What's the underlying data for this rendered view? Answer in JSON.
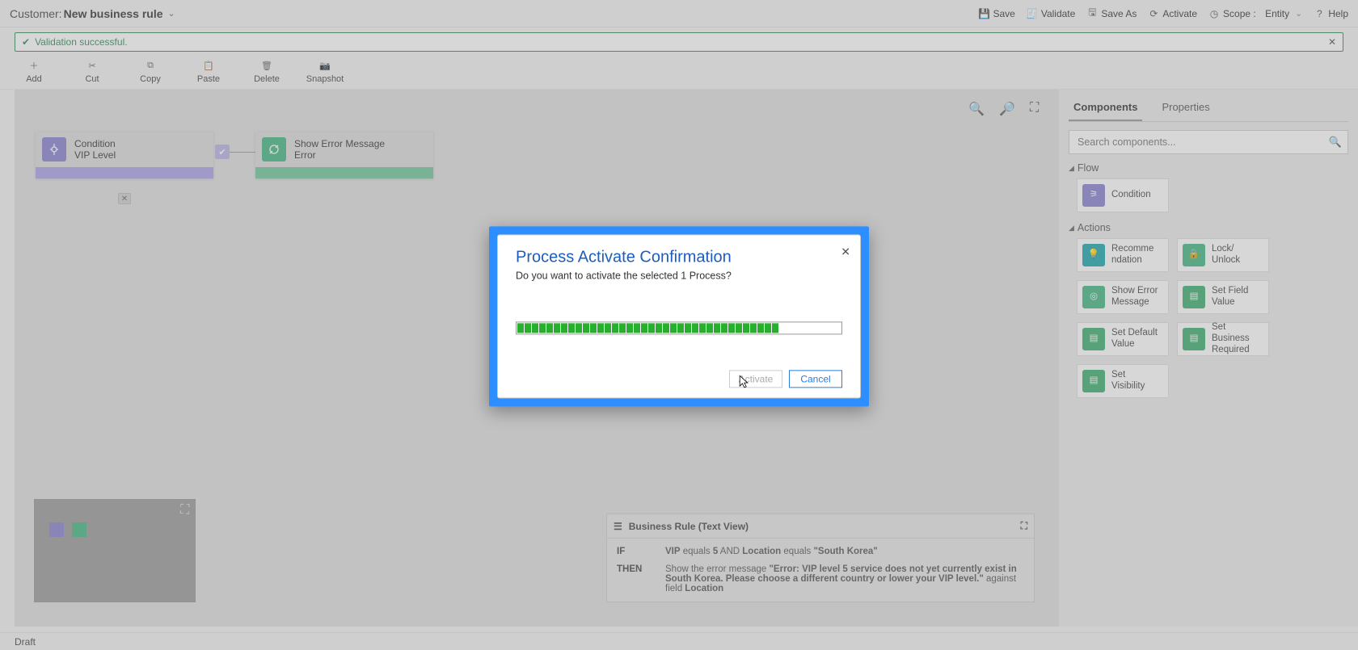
{
  "header": {
    "title_prefix": "Customer:",
    "title": "New business rule",
    "actions": {
      "save": "Save",
      "validate": "Validate",
      "save_as": "Save As",
      "activate": "Activate",
      "scope_label": "Scope :",
      "scope_value": "Entity",
      "help": "Help"
    }
  },
  "validation_banner": {
    "text": "Validation successful."
  },
  "toolbar": {
    "add": "Add",
    "cut": "Cut",
    "copy": "Copy",
    "paste": "Paste",
    "delete": "Delete",
    "snapshot": "Snapshot"
  },
  "canvas": {
    "condition_node": {
      "line1": "Condition",
      "line2": "VIP Level"
    },
    "error_node": {
      "line1": "Show Error Message",
      "line2": "Error"
    }
  },
  "textview": {
    "title": "Business Rule (Text View)",
    "if_label": "IF",
    "then_label": "THEN",
    "if_html_parts": {
      "p1": "VIP",
      "p2": " equals ",
      "p3": "5",
      "p4": " AND ",
      "p5": "Location",
      "p6": " equals ",
      "p7": "\"South Korea\""
    },
    "then_parts": {
      "lead": "Show the error message ",
      "quote": "\"Error: VIP level 5 service does not yet currently exist in South Korea. Please choose a different country or lower your VIP level.\"",
      "mid": " against field ",
      "field": "Location"
    }
  },
  "right_panel": {
    "tabs": {
      "components": "Components",
      "properties": "Properties"
    },
    "search_placeholder": "Search components...",
    "cat_flow": "Flow",
    "cat_actions": "Actions",
    "components": {
      "condition": "Condition",
      "recommendation": "Recomme\nndation",
      "lock_unlock": "Lock/\nUnlock",
      "show_error": "Show Error\nMessage",
      "set_field": "Set Field\nValue",
      "set_default": "Set Default\nValue",
      "set_business_required": "Set\nBusiness\nRequired",
      "set_visibility": "Set\nVisibility"
    }
  },
  "footer": {
    "status": "Draft"
  },
  "dialog": {
    "title": "Process Activate Confirmation",
    "message": "Do you want to activate the selected 1 Process?",
    "activate": "Activate",
    "cancel": "Cancel",
    "progress_fill_segments": 36,
    "progress_total_segments": 48
  }
}
